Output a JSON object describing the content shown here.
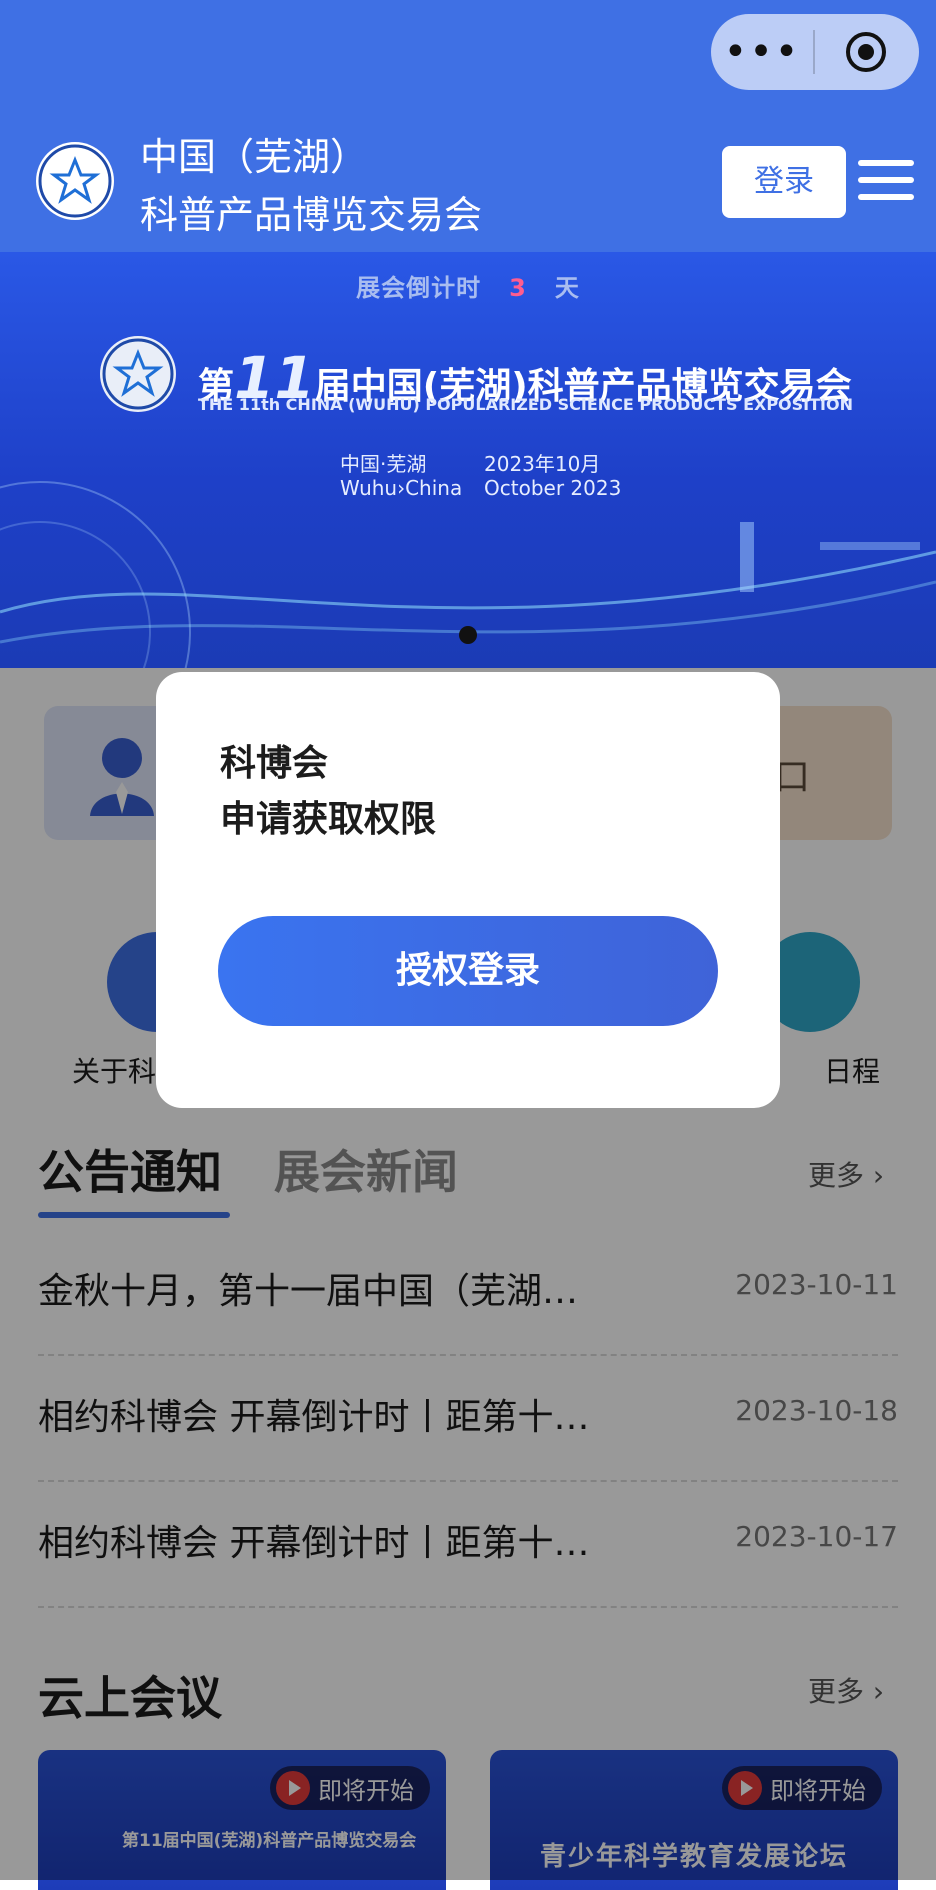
{
  "header": {
    "title_line1": "中国（芜湖）",
    "title_line2": "科普产品博览交易会",
    "login_label": "登录",
    "capsule_more": "•••"
  },
  "banner": {
    "countdown_label": "展会倒计时",
    "countdown_value": "3",
    "countdown_unit": "天",
    "title_prefix": "第",
    "title_number": "11",
    "title_suffix": "届中国(芜湖)科普产品博览交易会",
    "title_en": "THE 11th CHINA (WUHU) POPULARIZED SCIENCE PRODUCTS EXPOSITION",
    "location_cn": "中国·芜湖",
    "location_en": "Wuhu›China",
    "date_cn": "2023年10月",
    "date_en": "October 2023"
  },
  "quick_links": {
    "left_label": "关于科",
    "right_label": "日程",
    "right_card_char": "口"
  },
  "news": {
    "tab_active": "公告通知",
    "tab_inactive": "展会新闻",
    "more_label": "更多",
    "items": [
      {
        "title": "金秋十月，第十一届中国（芜湖…",
        "date": "2023-10-11"
      },
      {
        "title": "相约科博会 开幕倒计时丨距第十…",
        "date": "2023-10-18"
      },
      {
        "title": "相约科博会 开幕倒计时丨距第十…",
        "date": "2023-10-17"
      }
    ]
  },
  "meetings": {
    "section_title": "云上会议",
    "more_label": "更多",
    "cards": [
      {
        "badge": "即将开始",
        "caption": "第11届中国(芜湖)科普产品博览交易会"
      },
      {
        "badge": "即将开始",
        "caption": "青少年科学教育发展论坛"
      }
    ]
  },
  "modal": {
    "app_name": "科博会",
    "message": "申请获取权限",
    "button_label": "授权登录"
  },
  "colors": {
    "brand_blue": "#3f70e4",
    "countdown_number": "#ff5d8f"
  }
}
